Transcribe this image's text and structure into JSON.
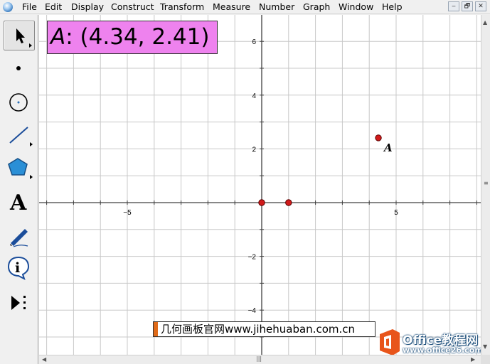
{
  "menubar": {
    "items": [
      "File",
      "Edit",
      "Display",
      "Construct",
      "Transform",
      "Measure",
      "Number",
      "Graph",
      "Window",
      "Help"
    ],
    "window_buttons": [
      "‒",
      "🗗",
      "✕"
    ]
  },
  "toolbox": {
    "tools": [
      "arrow-tool",
      "point-tool",
      "compass-tool",
      "straightedge-tool",
      "polygon-tool",
      "text-tool",
      "marker-tool",
      "information-tool",
      "custom-tool"
    ],
    "text_tool_glyph": "A",
    "info_glyph": "i"
  },
  "graph": {
    "x_ticks": [
      "−5",
      "5"
    ],
    "y_ticks": [
      "6",
      "4",
      "2",
      "−2",
      "−4"
    ],
    "point_label": "A",
    "points": [
      {
        "name": "origin",
        "x": 0,
        "y": 0
      },
      {
        "name": "unit-point",
        "x": 1,
        "y": 0
      },
      {
        "name": "A",
        "x": 4.34,
        "y": 2.41
      }
    ]
  },
  "measurement": {
    "point": "A",
    "text": ": (4.34, 2.41)"
  },
  "caption": {
    "text": "几何画板官网www.jihehuaban.com.cn"
  },
  "watermark": {
    "title": "Office教程网",
    "url": "www.office26.com"
  },
  "colors": {
    "measure_bg": "#ee82ee",
    "point_fill": "#d11a1a",
    "grid": "#c8c8c8",
    "axis": "#404040"
  }
}
